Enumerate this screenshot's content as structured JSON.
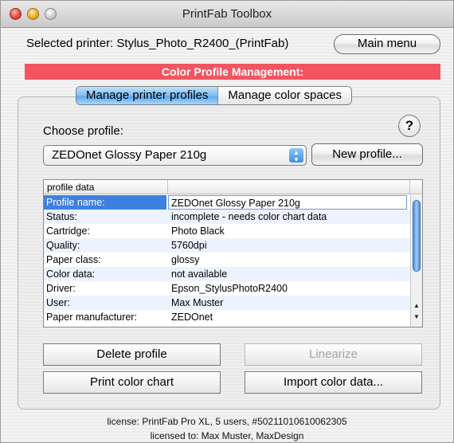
{
  "window": {
    "title": "PrintFab Toolbox"
  },
  "header": {
    "selected_printer": "Selected printer: Stylus_Photo_R2400_(PrintFab)",
    "main_menu_label": "Main menu"
  },
  "banner": {
    "text": "Color Profile Management:",
    "color": "#f25561"
  },
  "tabs": [
    {
      "label": "Manage printer profiles",
      "active": true
    },
    {
      "label": "Manage color spaces",
      "active": false
    }
  ],
  "profile_chooser": {
    "label": "Choose profile:",
    "selected": "ZEDOnet Glossy Paper 210g",
    "new_profile_label": "New profile...",
    "help_label": "?"
  },
  "table": {
    "header": "profile data",
    "rows": [
      {
        "key": "Profile name:",
        "value": "ZEDOnet Glossy Paper 210g"
      },
      {
        "key": "Status:",
        "value": "incomplete - needs color chart data"
      },
      {
        "key": "Cartridge:",
        "value": "Photo Black"
      },
      {
        "key": "Quality:",
        "value": "5760dpi"
      },
      {
        "key": "Paper class:",
        "value": "glossy"
      },
      {
        "key": "Color data:",
        "value": "not available"
      },
      {
        "key": "Driver:",
        "value": "Epson_StylusPhotoR2400"
      },
      {
        "key": "User:",
        "value": "Max Muster"
      },
      {
        "key": "Paper manufacturer:",
        "value": "ZEDOnet"
      }
    ]
  },
  "actions": {
    "delete_label": "Delete profile",
    "linearize_label": "Linearize",
    "print_chart_label": "Print color chart",
    "import_label": "Import color data..."
  },
  "footer": {
    "license_line1": "license: PrintFab Pro XL, 5 users, #50211010610062305",
    "license_line2": "licensed to: Max Muster, MaxDesign"
  }
}
